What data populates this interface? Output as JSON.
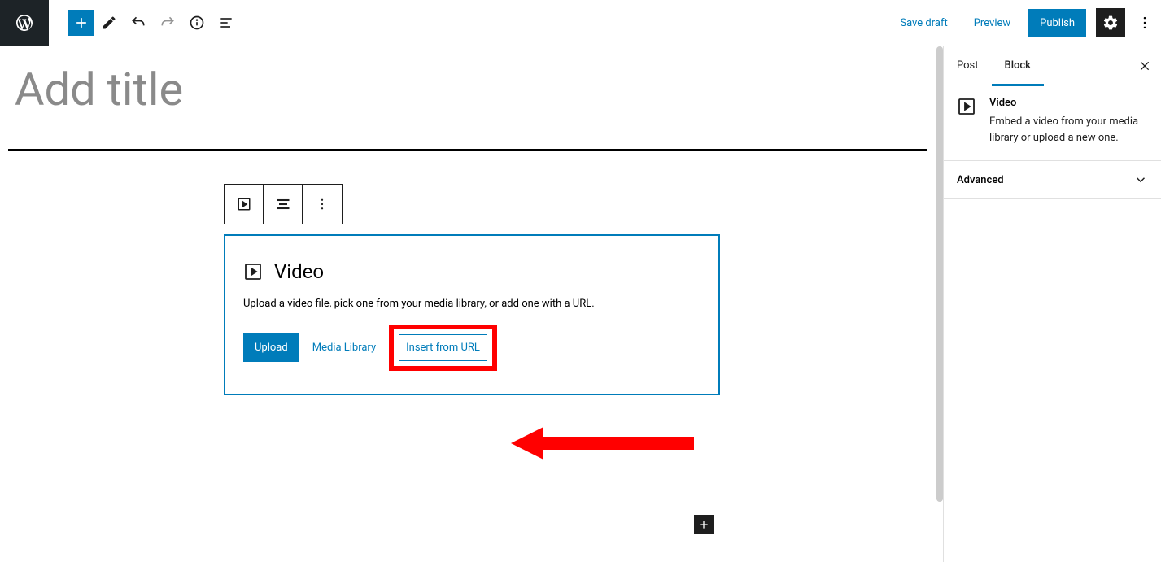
{
  "topbar": {
    "save_draft": "Save draft",
    "preview": "Preview",
    "publish": "Publish"
  },
  "editor": {
    "title_placeholder": "Add title",
    "video_block": {
      "title": "Video",
      "description": "Upload a video file, pick one from your media library, or add one with a URL.",
      "upload": "Upload",
      "media_library": "Media Library",
      "insert_from_url": "Insert from URL"
    }
  },
  "sidebar": {
    "tabs": {
      "post": "Post",
      "block": "Block"
    },
    "block_info": {
      "title": "Video",
      "description": "Embed a video from your media library or upload a new one."
    },
    "panels": {
      "advanced": "Advanced"
    }
  }
}
